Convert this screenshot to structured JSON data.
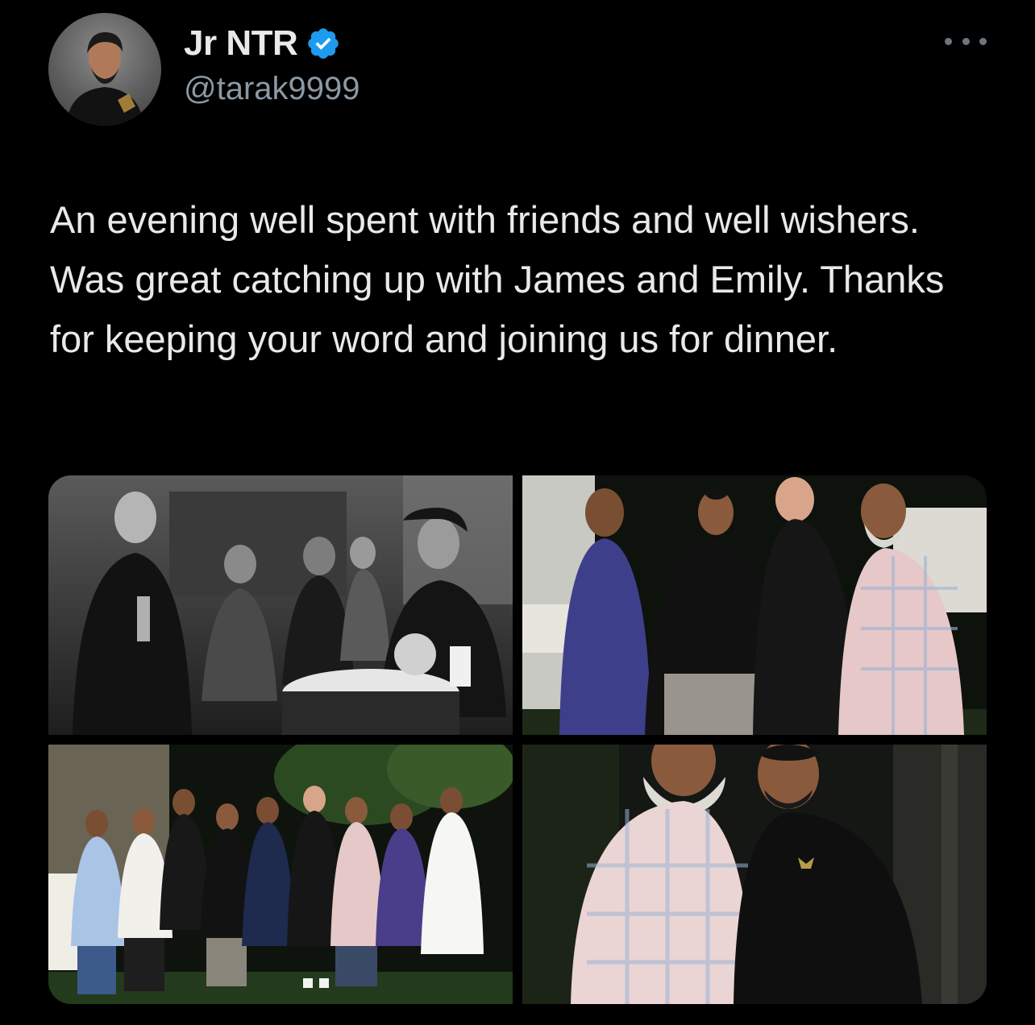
{
  "author": {
    "display_name": "Jr NTR",
    "handle": "@tarak9999",
    "verified": true,
    "verified_color": "#1d9bf0"
  },
  "icons": {
    "verified": "verified-badge-icon",
    "more": "more-options-icon"
  },
  "tweet": {
    "text": "An evening well spent with friends and well wishers. Was great catching up with James and Emily. Thanks for keeping your word and joining us for dinner."
  },
  "media": {
    "count": 4
  },
  "colors": {
    "background": "#000000",
    "text_primary": "#e7e9ea",
    "text_secondary": "#8b98a5"
  }
}
